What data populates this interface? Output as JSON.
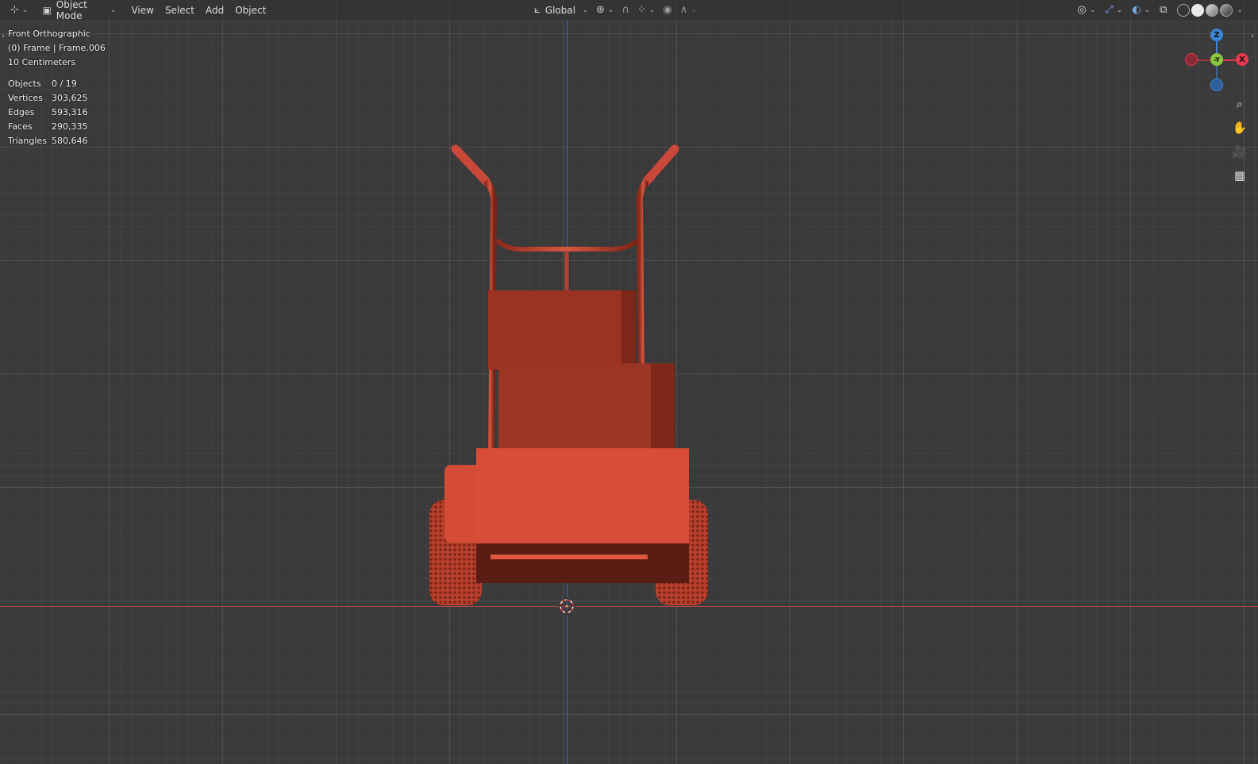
{
  "header": {
    "editor_type_icon": "view3d-icon",
    "mode": {
      "icon": "object-mode-icon",
      "label": "Object Mode"
    },
    "menus": [
      "View",
      "Select",
      "Add",
      "Object"
    ],
    "transform_orientation": {
      "icon": "orientation-icon",
      "label": "Global"
    },
    "pivot_icon": "pivot-point-icon",
    "snap_icon": "snap-magnet-icon",
    "snap_target_icon": "snap-increment-icon",
    "proportional_icon": "proportional-edit-icon",
    "falloff_icon": "falloff-curve-icon",
    "right_icons": [
      "visibility-eye-icon",
      "gizmo-toggle-icon",
      "overlay-toggle-icon",
      "xray-toggle-icon"
    ],
    "shading_modes": [
      "wireframe-shading-icon",
      "solid-shading-icon",
      "material-preview-icon",
      "rendered-shading-icon"
    ],
    "active_shading": "solid-shading-icon"
  },
  "overlay": {
    "view_name": "Front Orthographic",
    "object_info": "(0) Frame | Frame.006",
    "grid_scale": "10 Centimeters"
  },
  "stats": [
    {
      "label": "Objects",
      "value": "0 / 19"
    },
    {
      "label": "Vertices",
      "value": "303,625"
    },
    {
      "label": "Edges",
      "value": "593,316"
    },
    {
      "label": "Faces",
      "value": "290,335"
    },
    {
      "label": "Triangles",
      "value": "580,646"
    }
  ],
  "gizmo": {
    "z_label": "Z",
    "y_label": "-Y",
    "x_label": "X",
    "colors": {
      "x": "#e8384f",
      "y": "#8cc63f",
      "z": "#3d85d6"
    }
  },
  "nav_tools": [
    "zoom-icon",
    "pan-hand-icon",
    "camera-view-icon",
    "ortho-grid-icon"
  ],
  "colors": {
    "object": "#d94a35",
    "grid_bg": "#3a3a3a",
    "x_axis": "#b0474d",
    "z_axis": "#3c6ab4"
  }
}
